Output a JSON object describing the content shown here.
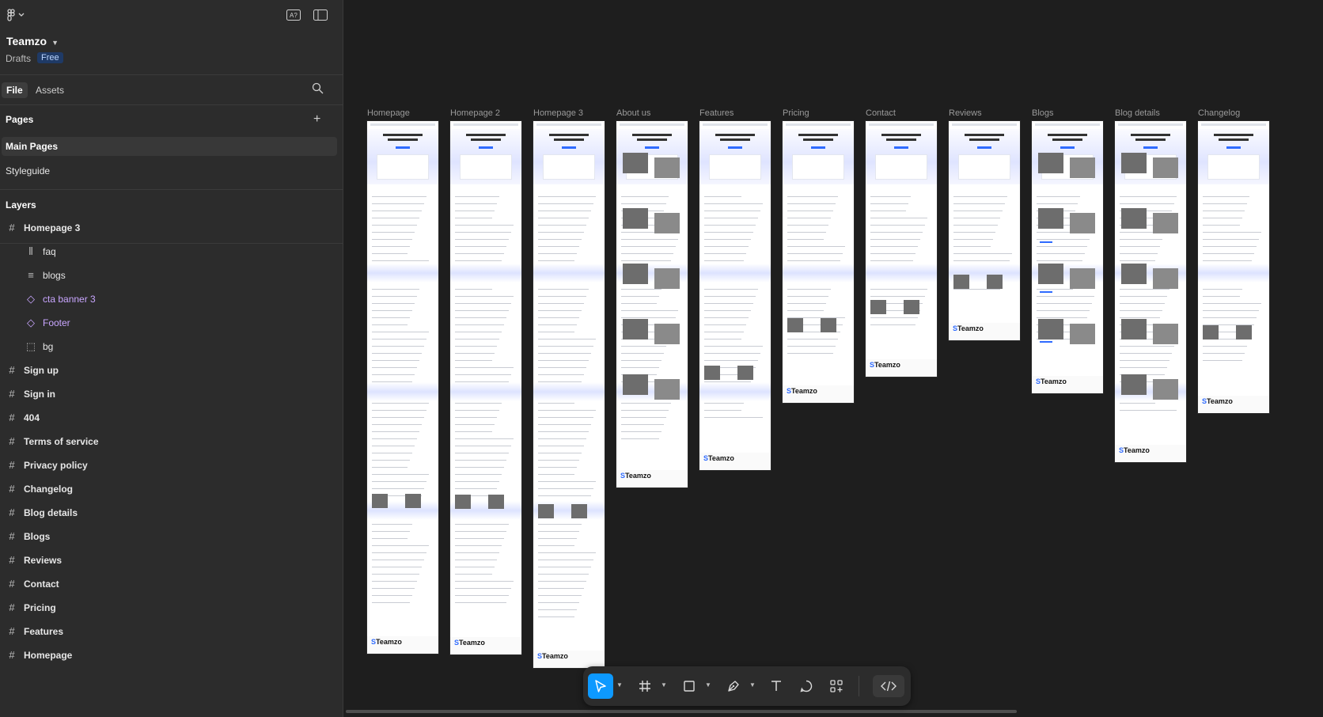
{
  "app": {
    "project_name": "Teamzo",
    "location": "Drafts",
    "plan_badge": "Free"
  },
  "tabs": [
    {
      "label": "File",
      "active": true
    },
    {
      "label": "Assets",
      "active": false
    }
  ],
  "pages": {
    "heading": "Pages",
    "items": [
      {
        "label": "Main Pages",
        "selected": true
      },
      {
        "label": "Styleguide",
        "selected": false
      }
    ]
  },
  "layers": {
    "heading": "Layers",
    "items": [
      {
        "label": "Homepage 3",
        "icon": "frame-icon",
        "level": 0
      },
      {
        "label": "faq",
        "icon": "auto-layout-icon",
        "level": 1
      },
      {
        "label": "blogs",
        "icon": "list-layout-icon",
        "level": 1
      },
      {
        "label": "cta banner 3",
        "icon": "component-instance-icon",
        "level": 1,
        "component": true
      },
      {
        "label": "Footer",
        "icon": "component-instance-icon",
        "level": 1,
        "component": true
      },
      {
        "label": "bg",
        "icon": "dashed-frame-icon",
        "level": 1
      },
      {
        "label": "Sign up",
        "icon": "frame-icon",
        "level": 0
      },
      {
        "label": "Sign in",
        "icon": "frame-icon",
        "level": 0
      },
      {
        "label": "404",
        "icon": "frame-icon",
        "level": 0
      },
      {
        "label": "Terms of service",
        "icon": "frame-icon",
        "level": 0
      },
      {
        "label": "Privacy policy",
        "icon": "frame-icon",
        "level": 0
      },
      {
        "label": "Changelog",
        "icon": "frame-icon",
        "level": 0
      },
      {
        "label": "Blog details",
        "icon": "frame-icon",
        "level": 0
      },
      {
        "label": "Blogs",
        "icon": "frame-icon",
        "level": 0
      },
      {
        "label": "Reviews",
        "icon": "frame-icon",
        "level": 0
      },
      {
        "label": "Contact",
        "icon": "frame-icon",
        "level": 0
      },
      {
        "label": "Pricing",
        "icon": "frame-icon",
        "level": 0
      },
      {
        "label": "Features",
        "icon": "frame-icon",
        "level": 0
      },
      {
        "label": "Homepage",
        "icon": "frame-icon",
        "level": 0
      }
    ]
  },
  "canvas": {
    "frames": [
      {
        "label": "Homepage"
      },
      {
        "label": "Homepage 2"
      },
      {
        "label": "Homepage 3"
      },
      {
        "label": "About us"
      },
      {
        "label": "Features"
      },
      {
        "label": "Pricing"
      },
      {
        "label": "Contact"
      },
      {
        "label": "Reviews"
      },
      {
        "label": "Blogs"
      },
      {
        "label": "Blog details"
      },
      {
        "label": "Changelog"
      }
    ],
    "brand_logo_text": "Teamzo"
  },
  "toolbar": {
    "tools": [
      {
        "name": "move-tool",
        "active": true
      },
      {
        "name": "frame-tool"
      },
      {
        "name": "shape-tool"
      },
      {
        "name": "pen-tool"
      },
      {
        "name": "text-tool"
      },
      {
        "name": "comment-tool"
      },
      {
        "name": "actions-tool"
      },
      {
        "name": "dev-mode-toggle"
      }
    ]
  },
  "colors": {
    "accent": "#0d99ff",
    "component": "#c9a6ff",
    "brand_blue": "#2f6bff"
  }
}
